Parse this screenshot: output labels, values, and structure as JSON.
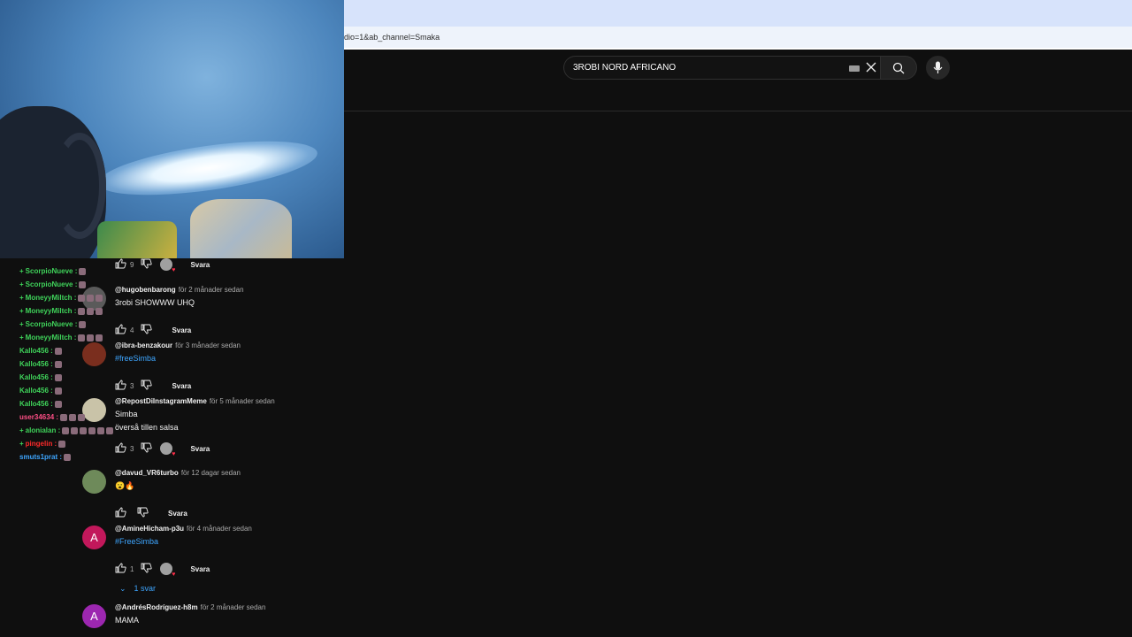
{
  "browser": {
    "url_fragment": "dio=1&ab_channel=Smaka"
  },
  "header": {
    "search_value": "3ROBI NORD AFRICANO"
  },
  "chat": [
    {
      "user": "ScorpioNueve :",
      "color": "#3fd35a",
      "badges": "+",
      "emotes": 1
    },
    {
      "user": "ScorpioNueve :",
      "color": "#3fd35a",
      "badges": "+",
      "emotes": 1
    },
    {
      "user": "MoneyyMiltch :",
      "color": "#3fd35a",
      "badges": "+",
      "emotes": 3
    },
    {
      "user": "MoneyyMiltch :",
      "color": "#3fd35a",
      "badges": "+",
      "emotes": 3
    },
    {
      "user": "ScorpioNueve :",
      "color": "#3fd35a",
      "badges": "+",
      "emotes": 1
    },
    {
      "user": "MoneyyMiltch :",
      "color": "#3fd35a",
      "badges": "+",
      "emotes": 3
    },
    {
      "user": "Kallo456 :",
      "color": "#3fd35a",
      "badges": "",
      "emotes": 1
    },
    {
      "user": "Kallo456 :",
      "color": "#3fd35a",
      "badges": "",
      "emotes": 1
    },
    {
      "user": "Kallo456 :",
      "color": "#3fd35a",
      "badges": "",
      "emotes": 1
    },
    {
      "user": "Kallo456 :",
      "color": "#3fd35a",
      "badges": "",
      "emotes": 1
    },
    {
      "user": "Kallo456 :",
      "color": "#3fd35a",
      "badges": "",
      "emotes": 1
    },
    {
      "user": "user34634 :",
      "color": "#ff4f86",
      "badges": "",
      "emotes": 3
    },
    {
      "user": "alonialan :",
      "color": "#3fd35a",
      "badges": "+",
      "emotes": 6
    },
    {
      "user": "pingelin :",
      "color": "#ff2a2a",
      "badges": "+",
      "emotes": 1
    },
    {
      "user": "smuts1prat :",
      "color": "#3ea6ff",
      "badges": "",
      "emotes": 1
    }
  ],
  "comments": [
    {
      "author": "",
      "time": "",
      "text": "",
      "likes": "9",
      "reply_label": "Svara",
      "creator_heart": true,
      "avatar_color": ""
    },
    {
      "author": "@hugobenbarong",
      "time": "för 2 månader sedan",
      "text": "3robi SHOWWW UHQ",
      "likes": "4",
      "reply_label": "Svara",
      "creator_heart": false,
      "avatar_color": ""
    },
    {
      "author": "@ibra-benzakour",
      "time": "för 3 månader sedan",
      "text": "#freeSimba",
      "likes": "3",
      "reply_label": "Svara",
      "creator_heart": false,
      "avatar_color": "#7a2e1e"
    },
    {
      "author": "@RepostDiInstagramMeme",
      "time": "för 5 månader sedan",
      "text": "Simba",
      "text2": "överså tillen salsa",
      "likes": "3",
      "reply_label": "Svara",
      "creator_heart": true,
      "avatar_color": "#c9c3a8"
    },
    {
      "author": "@davud_VR6turbo",
      "time": "för 12 dagar sedan",
      "text": "😮🔥",
      "likes": "",
      "reply_label": "Svara",
      "creator_heart": false,
      "avatar_color": "#6e8a5a"
    },
    {
      "author": "@AmineHicham-p3u",
      "time": "för 4 månader sedan",
      "text": "#FreeSimba",
      "likes": "1",
      "reply_label": "Svara",
      "creator_heart": true,
      "avatar_color": "#c2185b",
      "avatar_letter": "A",
      "replies_label": "1 svar"
    },
    {
      "author": "@AndrésRodríguez-h8m",
      "time": "för 2 månader sedan",
      "text": "MAMA",
      "likes": "",
      "reply_label": "",
      "creator_heart": false,
      "avatar_color": "#9c27b0",
      "avatar_letter": "A"
    }
  ]
}
